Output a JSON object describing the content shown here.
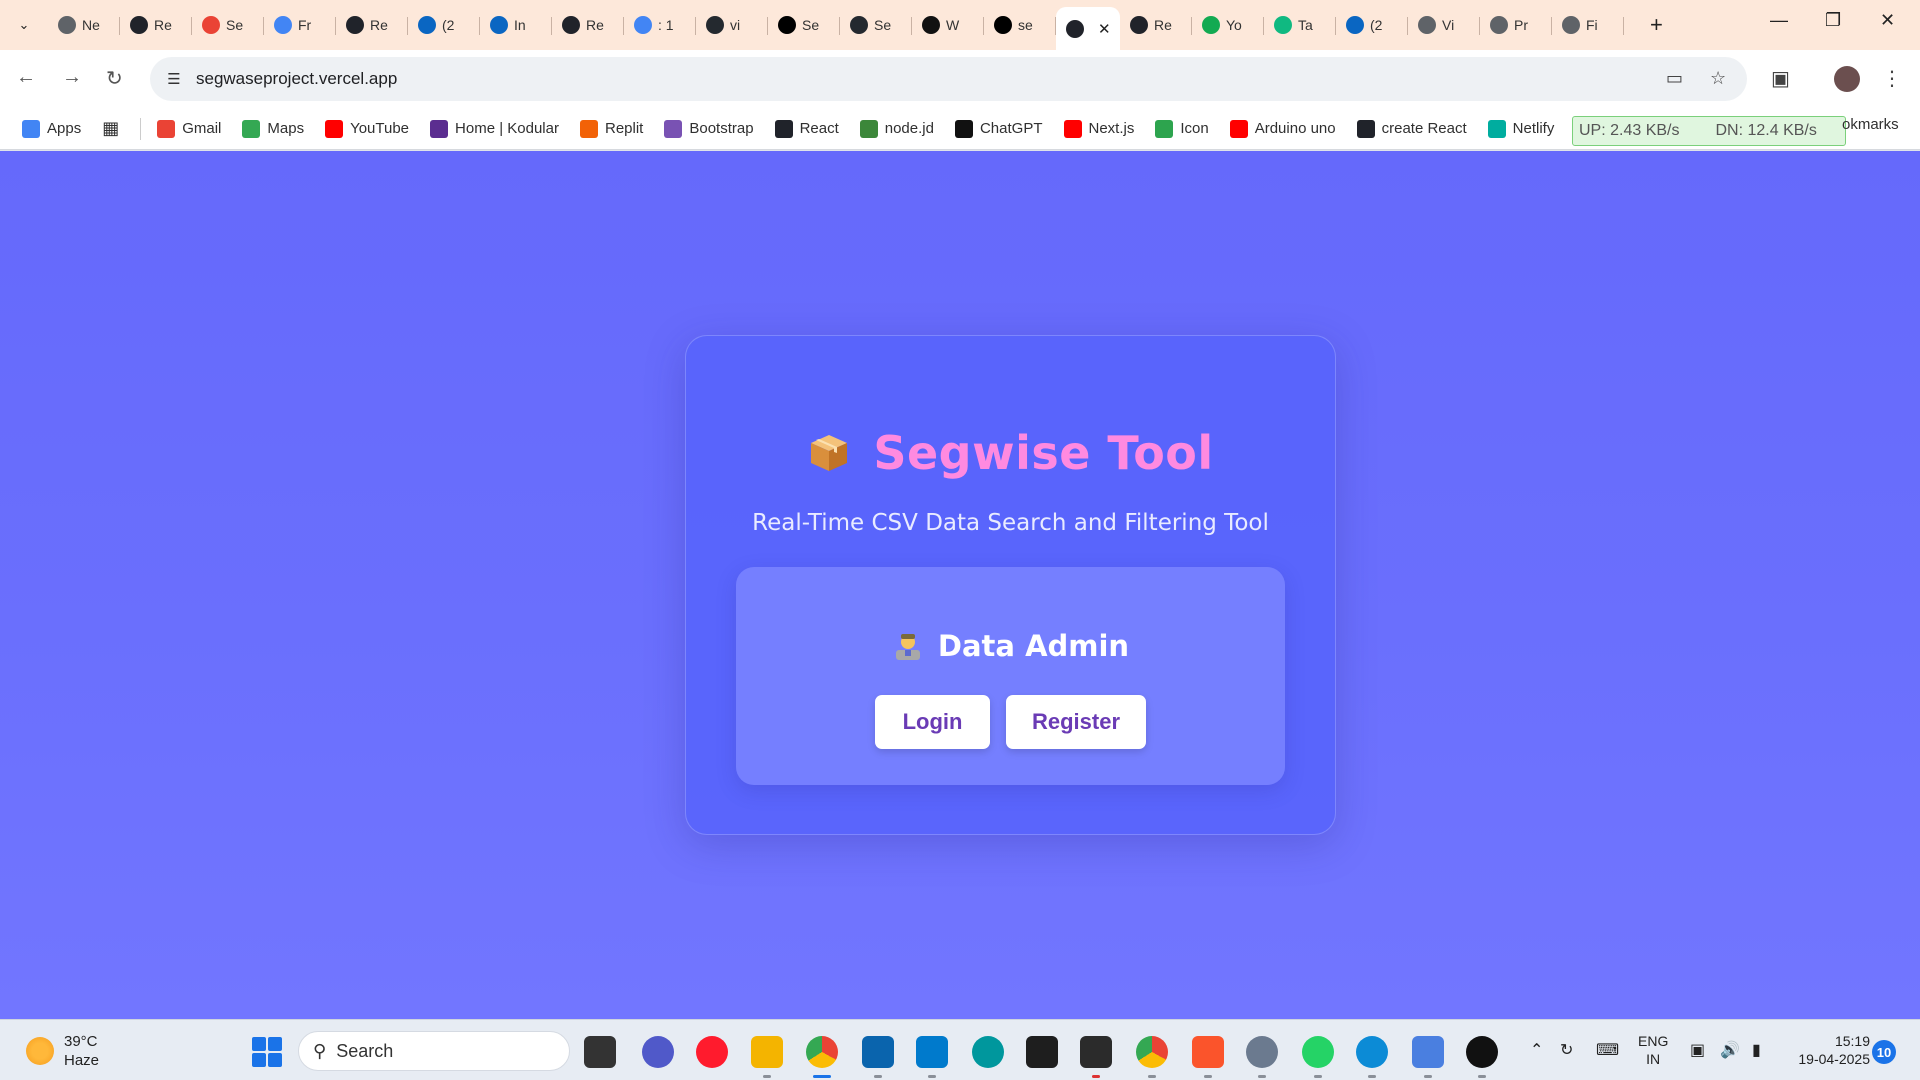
{
  "browser": {
    "tabs": [
      {
        "label": "Ne",
        "icon": "chrome-icon",
        "color": "#5f6368"
      },
      {
        "label": "Re",
        "icon": "react-icon",
        "color": "#20232a"
      },
      {
        "label": "Se",
        "icon": "gmail-icon",
        "color": "#ea4335"
      },
      {
        "label": "Fr",
        "icon": "docs-icon",
        "color": "#4285f4"
      },
      {
        "label": "Re",
        "icon": "react-icon",
        "color": "#20232a"
      },
      {
        "label": "(2",
        "icon": "linkedin-icon",
        "color": "#0a66c2"
      },
      {
        "label": "In",
        "icon": "infosys-icon",
        "color": "#0a66c2"
      },
      {
        "label": "Re",
        "icon": "react-icon",
        "color": "#20232a"
      },
      {
        "label": ": 1",
        "icon": "google-icon",
        "color": "#4285f4"
      },
      {
        "label": "vi",
        "icon": "github-icon",
        "color": "#24292f"
      },
      {
        "label": "Se",
        "icon": "render-icon",
        "color": "#000000"
      },
      {
        "label": "Se",
        "icon": "github-icon",
        "color": "#24292f"
      },
      {
        "label": "W",
        "icon": "openai-icon",
        "color": "#111111"
      },
      {
        "label": "se",
        "icon": "vercel-icon",
        "color": "#000000"
      },
      {
        "label": "",
        "icon": "react-icon",
        "color": "#20232a",
        "active": true
      },
      {
        "label": "Re",
        "icon": "react-icon",
        "color": "#20232a"
      },
      {
        "label": "Yo",
        "icon": "mongodb-icon",
        "color": "#13aa52"
      },
      {
        "label": "Ta",
        "icon": "sgpt-icon",
        "color": "#10b981"
      },
      {
        "label": "(2",
        "icon": "linkedin-icon",
        "color": "#0a66c2"
      },
      {
        "label": "Vi",
        "icon": "globe-icon",
        "color": "#5f6368"
      },
      {
        "label": "Pr",
        "icon": "globe-icon",
        "color": "#5f6368"
      },
      {
        "label": "Fi",
        "icon": "globe-icon",
        "color": "#5f6368"
      }
    ],
    "url": "segwaseproject.vercel.app"
  },
  "bookmarks": [
    {
      "label": "Apps",
      "icon": "apps-grid-icon",
      "color": "#4285f4"
    },
    {
      "label": "Gmail",
      "icon": "gmail-icon",
      "color": "#ea4335"
    },
    {
      "label": "Maps",
      "icon": "maps-icon",
      "color": "#34a853"
    },
    {
      "label": "YouTube",
      "icon": "youtube-icon",
      "color": "#ff0000"
    },
    {
      "label": "Home | Kodular",
      "icon": "kodular-icon",
      "color": "#5b2d90"
    },
    {
      "label": "Replit",
      "icon": "replit-icon",
      "color": "#f26207"
    },
    {
      "label": "Bootstrap",
      "icon": "bootstrap-icon",
      "color": "#7952b3"
    },
    {
      "label": "React",
      "icon": "react-icon",
      "color": "#20232a"
    },
    {
      "label": "node.jd",
      "icon": "nodejs-icon",
      "color": "#3c873a"
    },
    {
      "label": "ChatGPT",
      "icon": "openai-icon",
      "color": "#111111"
    },
    {
      "label": "Next.js",
      "icon": "youtube-icon",
      "color": "#ff0000"
    },
    {
      "label": "Icon",
      "icon": "icon-site-icon",
      "color": "#2da44e"
    },
    {
      "label": "Arduino uno",
      "icon": "youtube-icon",
      "color": "#ff0000"
    },
    {
      "label": "create React",
      "icon": "react-icon",
      "color": "#20232a"
    },
    {
      "label": "Netlify",
      "icon": "netlify-icon",
      "color": "#00ad9f"
    }
  ],
  "bookmarks_more": "okmarks",
  "netspeed": {
    "up": "UP: 2.43 KB/s",
    "down": "DN: 12.4 KB/s"
  },
  "app": {
    "title": "Segwise Tool",
    "subtitle": "Real-Time CSV Data Search and Filtering Tool",
    "panel_title": "Data Admin",
    "login_label": "Login",
    "register_label": "Register",
    "title_color": "#ff8ae0",
    "accent": "#6a3bb5",
    "background": "#6a6ffd"
  },
  "taskbar": {
    "temperature": "39°C",
    "condition": "Haze",
    "search_placeholder": "Search",
    "lang_top": "ENG",
    "lang_bottom": "IN",
    "time": "15:19",
    "date": "19-04-2025",
    "notifications": "10"
  }
}
